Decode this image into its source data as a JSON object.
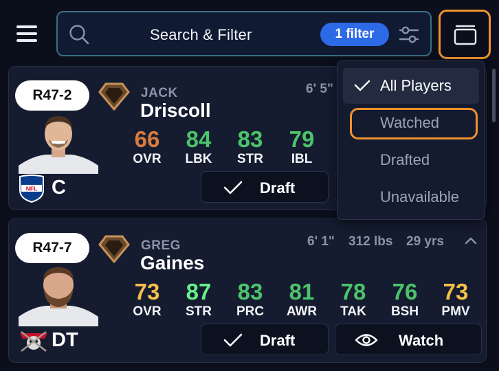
{
  "header": {
    "search_label": "Search & Filter",
    "filter_badge": "1 filter"
  },
  "colors": {
    "accent_orange": "#f0922e",
    "filter_blue": "#2c6ae6",
    "stat_orange": "#d97a3e",
    "stat_green": "#4cc36b",
    "stat_bright_green": "#66f08a",
    "stat_yellow": "#f4c04a"
  },
  "cards": [
    {
      "pick": "R47-2",
      "first_name": "JACK",
      "last_name": "Driscoll",
      "height": "6' 5\"",
      "position": "C",
      "team_logo": "NFL",
      "stats": [
        {
          "value": "66",
          "label": "OVR",
          "color": "#d97a3e"
        },
        {
          "value": "84",
          "label": "LBK",
          "color": "#4cc36b"
        },
        {
          "value": "83",
          "label": "STR",
          "color": "#4cc36b"
        },
        {
          "value": "79",
          "label": "IBL",
          "color": "#4cc36b"
        }
      ],
      "draft_label": "Draft"
    },
    {
      "pick": "R47-7",
      "first_name": "GREG",
      "last_name": "Gaines",
      "height": "6' 1\"",
      "weight": "312 lbs",
      "age": "29 yrs",
      "position": "DT",
      "stats": [
        {
          "value": "73",
          "label": "OVR",
          "color": "#f4c04a"
        },
        {
          "value": "87",
          "label": "STR",
          "color": "#66f08a"
        },
        {
          "value": "83",
          "label": "PRC",
          "color": "#4cc36b"
        },
        {
          "value": "81",
          "label": "AWR",
          "color": "#4cc36b"
        },
        {
          "value": "78",
          "label": "TAK",
          "color": "#4cc36b"
        },
        {
          "value": "76",
          "label": "BSH",
          "color": "#4cc36b"
        },
        {
          "value": "73",
          "label": "PMV",
          "color": "#f4c04a"
        }
      ],
      "draft_label": "Draft",
      "watch_label": "Watch"
    }
  ],
  "dropdown": {
    "items": [
      {
        "label": "All Players",
        "selected": true
      },
      {
        "label": "Watched",
        "selected": false
      },
      {
        "label": "Drafted",
        "selected": false
      },
      {
        "label": "Unavailable",
        "selected": false
      }
    ]
  }
}
